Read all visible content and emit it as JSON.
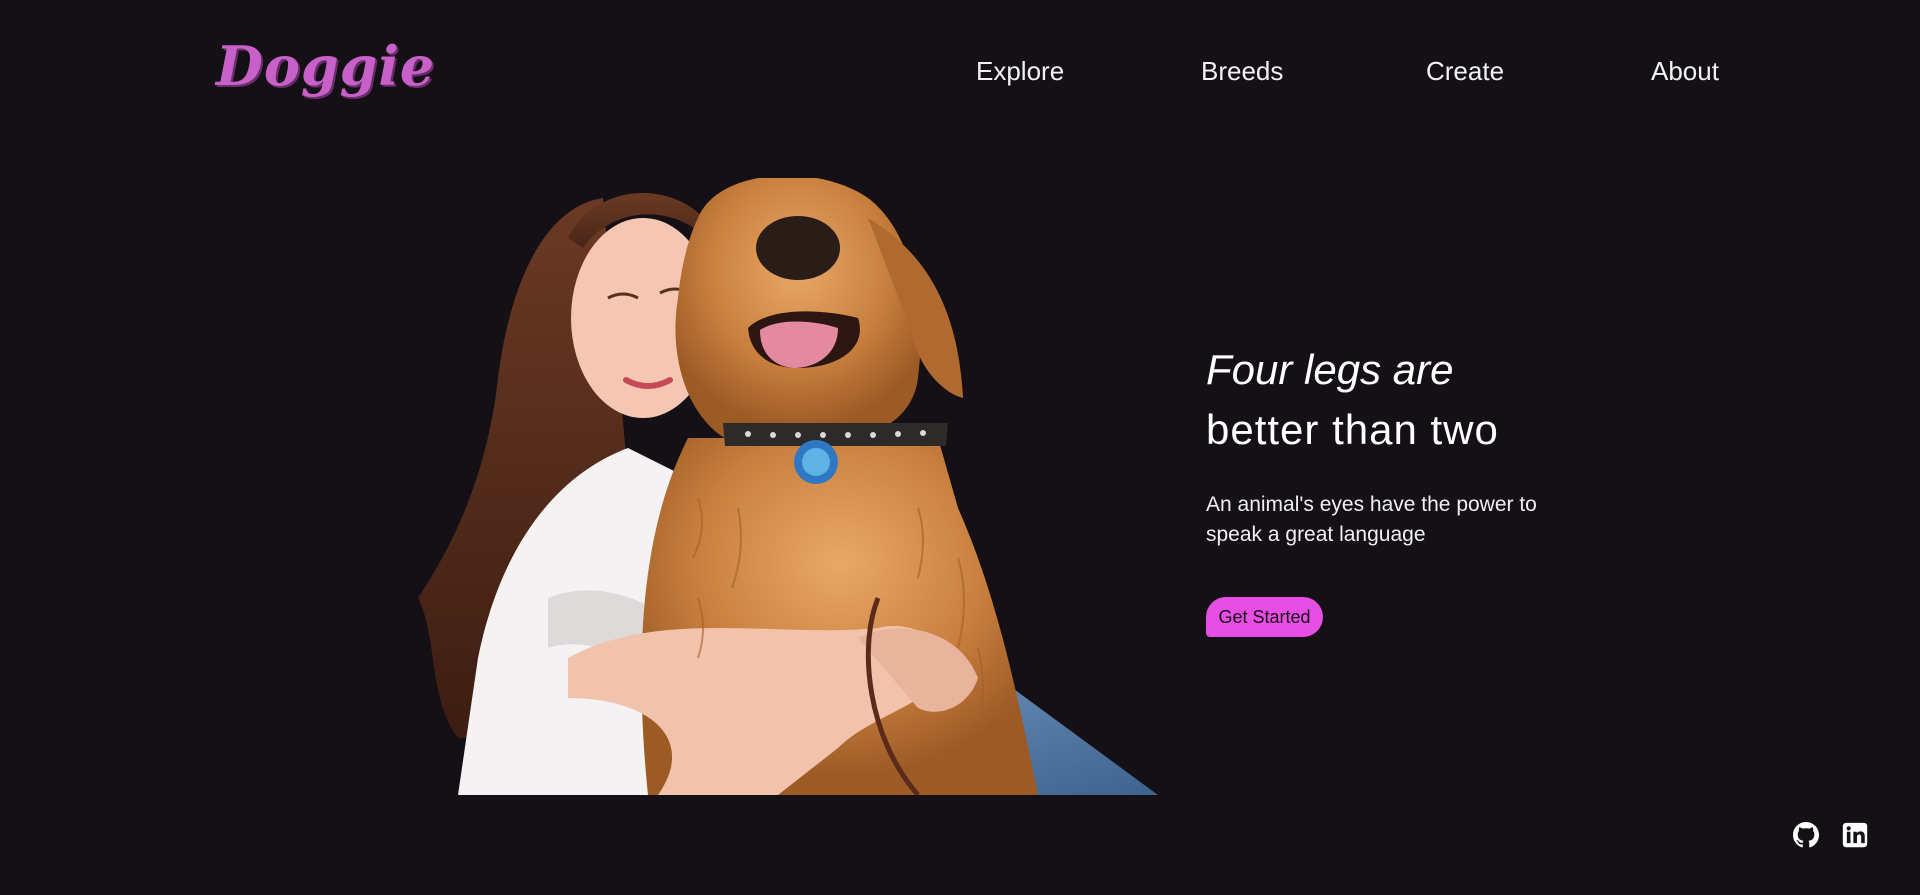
{
  "brand": {
    "logo_text": "Doggie",
    "logo_color": "#c860c9"
  },
  "nav": {
    "items": [
      {
        "label": "Explore"
      },
      {
        "label": "Breeds"
      },
      {
        "label": "Create"
      },
      {
        "label": "About"
      }
    ]
  },
  "hero": {
    "image_alt": "woman hugging golden retriever",
    "headline_line1": "Four legs are",
    "headline_line2": "better than two",
    "subtitle": "An animal's eyes have the power to speak a great language",
    "cta_label": "Get Started",
    "cta_color": "#e74ee3"
  },
  "social": [
    {
      "icon": "github-icon"
    },
    {
      "icon": "linkedin-icon"
    }
  ],
  "colors": {
    "background": "#141016",
    "text": "#ffffff"
  }
}
